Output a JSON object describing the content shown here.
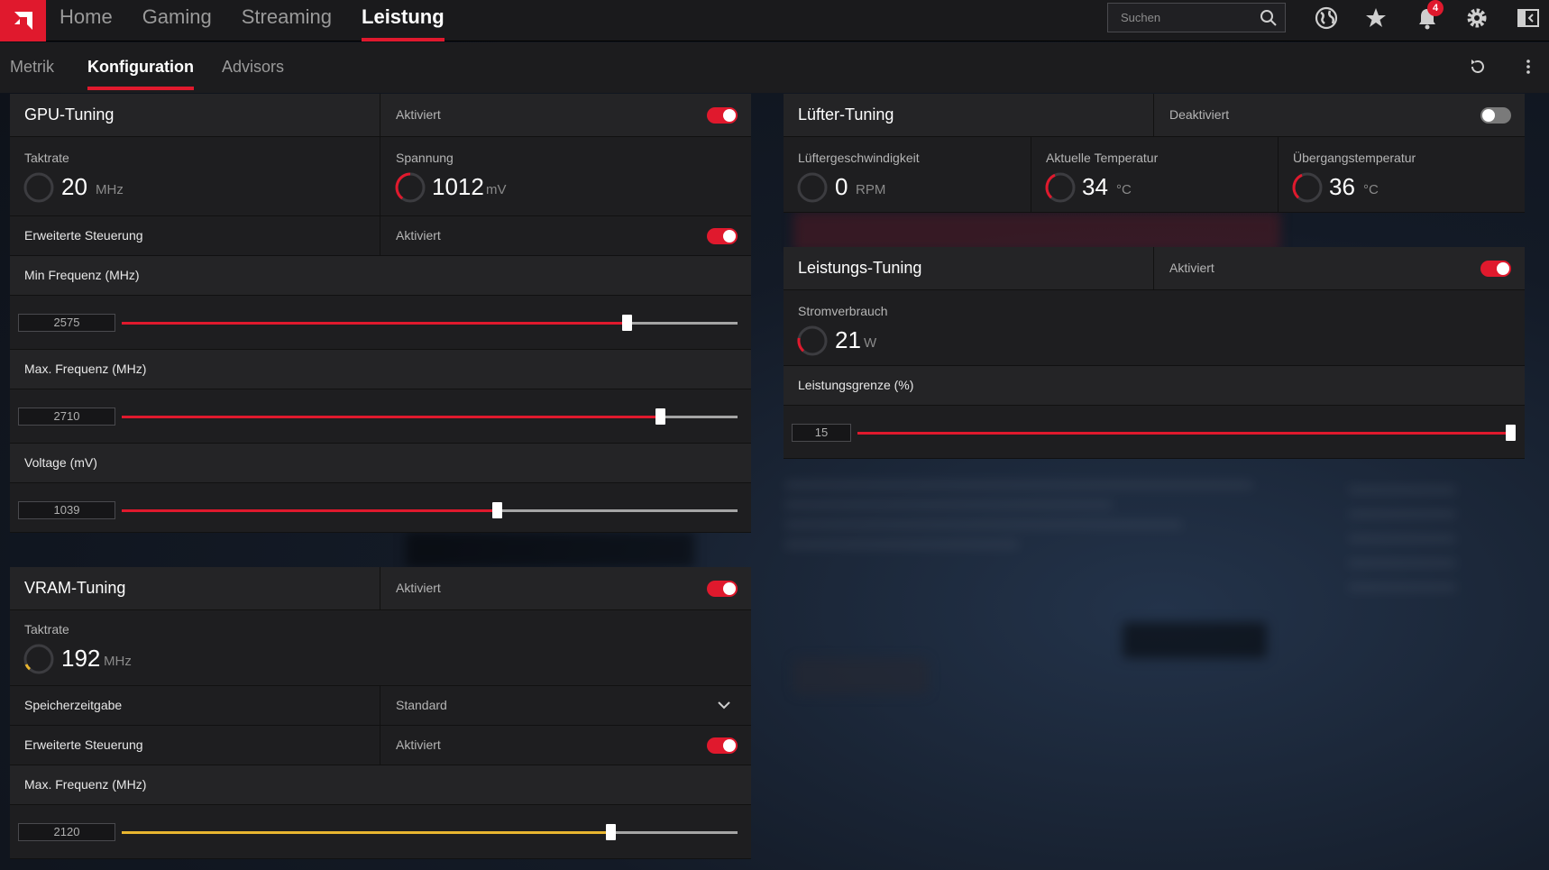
{
  "topnav": {
    "items": [
      "Home",
      "Gaming",
      "Streaming",
      "Leistung"
    ],
    "active": "Leistung",
    "search_placeholder": "Suchen",
    "notification_count": "4"
  },
  "subnav": {
    "tabs": [
      "Metrik",
      "Konfiguration",
      "Advisors"
    ],
    "active": "Konfiguration"
  },
  "colors": {
    "accent": "#e0192d",
    "vram_accent": "#e8b530",
    "panel": "#1e1e20"
  },
  "gpu": {
    "title": "GPU-Tuning",
    "status": "Aktiviert",
    "taktrate_label": "Taktrate",
    "taktrate_value": "20",
    "taktrate_unit": "MHz",
    "spannung_label": "Spannung",
    "spannung_value": "1012",
    "spannung_unit": "mV",
    "advanced_label": "Erweiterte Steuerung",
    "advanced_status": "Aktiviert",
    "min_label": "Min Frequenz (MHz)",
    "min_value": "2575",
    "min_fraction": 0.82,
    "max_label": "Max. Frequenz (MHz)",
    "max_value": "2710",
    "max_fraction": 0.875,
    "voltage_label": "Voltage (mV)",
    "voltage_value": "1039",
    "voltage_fraction": 0.61
  },
  "vram": {
    "title": "VRAM-Tuning",
    "status": "Aktiviert",
    "taktrate_label": "Taktrate",
    "taktrate_value": "192",
    "taktrate_unit": "MHz",
    "timing_label": "Speicherzeitgabe",
    "timing_value": "Standard",
    "advanced_label": "Erweiterte Steuerung",
    "advanced_status": "Aktiviert",
    "max_label": "Max. Frequenz (MHz)",
    "max_value": "2120",
    "max_fraction": 0.795
  },
  "fan": {
    "title": "Lüfter-Tuning",
    "status": "Deaktiviert",
    "speed_label": "Lüftergeschwindigkeit",
    "speed_value": "0",
    "speed_unit": "RPM",
    "temp_label": "Aktuelle Temperatur",
    "temp_value": "34",
    "temp_unit": "°C",
    "junction_label": "Übergangstemperatur",
    "junction_value": "36",
    "junction_unit": "°C"
  },
  "power": {
    "title": "Leistungs-Tuning",
    "status": "Aktiviert",
    "consumption_label": "Stromverbrauch",
    "consumption_value": "21",
    "consumption_unit": "W",
    "limit_label": "Leistungsgrenze (%)",
    "limit_value": "15",
    "limit_fraction": 1.0
  }
}
